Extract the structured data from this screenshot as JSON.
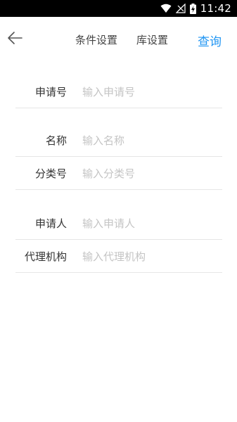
{
  "status_bar": {
    "time": "11:42",
    "icons": [
      "wifi-icon",
      "no-signal-icon",
      "battery-charging-icon"
    ]
  },
  "toolbar": {
    "back_icon": "arrow-left-icon",
    "tabs": [
      {
        "label": "条件设置"
      },
      {
        "label": "库设置"
      }
    ],
    "query_label": "查询",
    "accent_color": "#2196f3"
  },
  "form": {
    "fields": [
      {
        "label": "申请号",
        "placeholder": "输入申请号",
        "value": ""
      },
      {
        "label": "名称",
        "placeholder": "输入名称",
        "value": ""
      },
      {
        "label": "分类号",
        "placeholder": "输入分类号",
        "value": ""
      },
      {
        "label": "申请人",
        "placeholder": "输入申请人",
        "value": ""
      },
      {
        "label": "代理机构",
        "placeholder": "输入代理机构",
        "value": ""
      }
    ]
  }
}
